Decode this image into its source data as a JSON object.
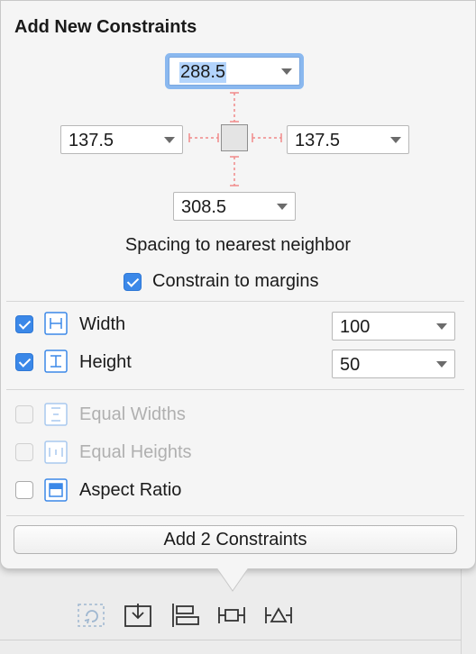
{
  "popover": {
    "title": "Add New Constraints",
    "spacing": {
      "top": "288.5",
      "left": "137.5",
      "right": "137.5",
      "bottom": "308.5"
    },
    "spacing_label": "Spacing to nearest neighbor",
    "constrain_to_margins": {
      "label": "Constrain to margins",
      "checked": true
    },
    "constraints": [
      {
        "label": "Width",
        "checked": true,
        "value": "100",
        "enabled": true
      },
      {
        "label": "Height",
        "checked": true,
        "value": "50",
        "enabled": true
      },
      {
        "label": "Equal Widths",
        "checked": false,
        "enabled": false
      },
      {
        "label": "Equal Heights",
        "checked": false,
        "enabled": false
      },
      {
        "label": "Aspect Ratio",
        "checked": false,
        "enabled": true
      }
    ],
    "add_button_label": "Add 2 Constraints"
  },
  "toolbar": {
    "icons": [
      "update-frames-icon",
      "embed-in-stack-icon",
      "align-icon",
      "pin-icon",
      "resolve-issues-icon"
    ]
  },
  "colors": {
    "accent": "#3b88e8",
    "focus_ring": "#8ab8ef",
    "strut": "#f08a8a"
  }
}
